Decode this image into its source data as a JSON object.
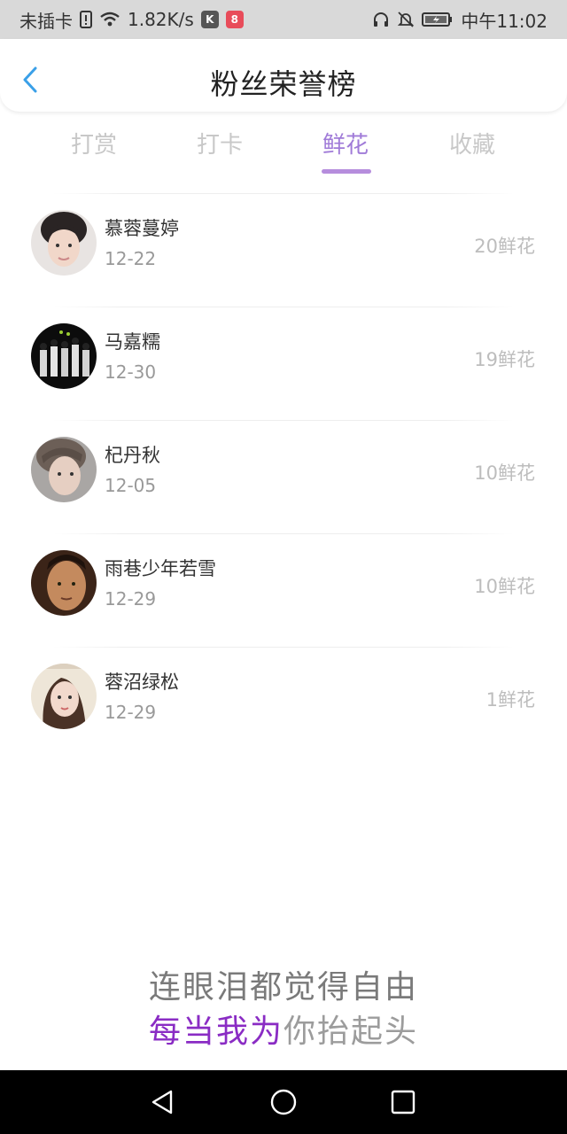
{
  "status_bar": {
    "carrier": "未插卡",
    "speed": "1.82K/s",
    "time": "中午11:02"
  },
  "header": {
    "title": "粉丝荣誉榜"
  },
  "tabs": [
    {
      "label": "打赏",
      "active": false
    },
    {
      "label": "打卡",
      "active": false
    },
    {
      "label": "鲜花",
      "active": true
    },
    {
      "label": "收藏",
      "active": false
    }
  ],
  "fans": [
    {
      "name": "慕蓉蔓婷",
      "date": "12-22",
      "amount": "20鲜花"
    },
    {
      "name": "马嘉糯",
      "date": "12-30",
      "amount": "19鲜花"
    },
    {
      "name": "杞丹秋",
      "date": "12-05",
      "amount": "10鲜花"
    },
    {
      "name": "雨巷少年若雪",
      "date": "12-29",
      "amount": "10鲜花"
    },
    {
      "name": "蓉沼绿松",
      "date": "12-29",
      "amount": "1鲜花"
    }
  ],
  "lyrics": {
    "line1": "连眼泪都觉得自由",
    "line2_highlight": "每当我为",
    "line2_rest": "你抬起头"
  },
  "colors": {
    "accent": "#a07bd8",
    "lyric_highlight": "#8a2cc4",
    "back_arrow": "#3aa0e8"
  }
}
